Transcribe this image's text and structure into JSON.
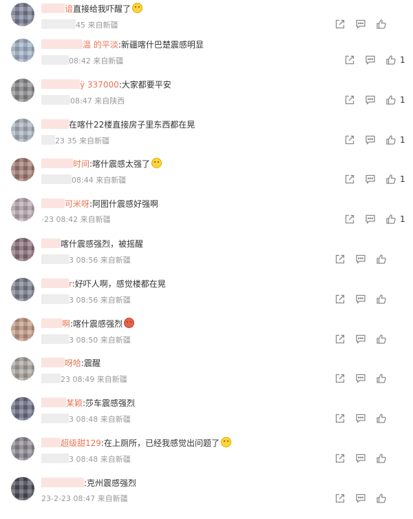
{
  "comments": [
    {
      "nick": "谙",
      "text": "直接给我吓醒了",
      "emoji": "yellow",
      "time": "45",
      "location": "来自新疆",
      "likes": ""
    },
    {
      "nick": "温 的平淡",
      "text": ":新疆喀什巴楚震感明显",
      "emoji": "",
      "time": "08:42",
      "location": "来自新疆",
      "likes": "1"
    },
    {
      "nick": "ÿ 337000",
      "text": ":大家都要平安",
      "emoji": "",
      "time": "08:47",
      "location": "来自陕西",
      "likes": "1"
    },
    {
      "nick": "",
      "text": "在喀什22楼直接房子里东西都在晃",
      "emoji": "",
      "time": "23 35",
      "location": "来自新疆",
      "likes": "1"
    },
    {
      "nick": "时间",
      "text": ":喀什震感太强了",
      "emoji": "yellow",
      "time": "08:44",
      "location": "来自新疆",
      "likes": "1"
    },
    {
      "nick": "可米呀",
      "text": ":阿图什震感好强啊",
      "emoji": "",
      "time": "-23 08:42",
      "location": "来自新疆",
      "likes": "1"
    },
    {
      "nick": "",
      "text": "喀什震感强烈，被摇醒",
      "emoji": "",
      "time": "3 08:56",
      "location": "来自新疆",
      "likes": ""
    },
    {
      "nick": "r",
      "text": ":好吓人啊，感觉楼都在晃",
      "emoji": "",
      "time": "3 08:56",
      "location": "来自新疆",
      "likes": ""
    },
    {
      "nick": "啊",
      "text": ":喀什震感强烈",
      "emoji": "red",
      "time": "3 08:50",
      "location": "来自新疆",
      "likes": ""
    },
    {
      "nick": "呀哈",
      "text": ":震醒",
      "emoji": "",
      "time": "23 08:49",
      "location": "来自新疆",
      "likes": ""
    },
    {
      "nick": "某颖",
      "text": ":莎车震感强烈",
      "emoji": "",
      "time": "3 08:48",
      "location": "来自新疆",
      "likes": ""
    },
    {
      "nick": "超级甜129",
      "text": ":在上厕所，已经我感觉出问题了",
      "emoji": "yellow",
      "time": "3 08:48",
      "location": "来自新疆",
      "likes": ""
    },
    {
      "nick": "",
      "text": ":克州震感强烈",
      "emoji": "",
      "time": "23-2-23 08:47",
      "location": "来自新疆",
      "likes": ""
    }
  ],
  "colors": {
    "nickname": "#eb7350",
    "icon": "#8a8a8a",
    "mask": "#fbe4e0"
  },
  "icons": [
    "forward-icon",
    "comment-icon",
    "like-icon"
  ]
}
